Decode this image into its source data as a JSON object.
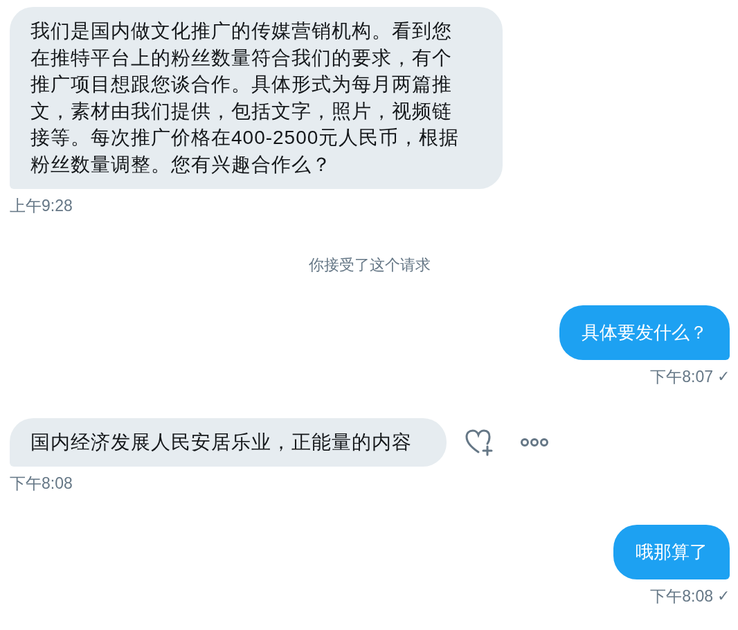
{
  "messages": [
    {
      "kind": "received",
      "text": "我们是国内做文化推广的传媒营销机构。看到您在推特平台上的粉丝数量符合我们的要求，有个推广项目想跟您谈合作。具体形式为每月两篇推文，素材由我们提供，包括文字，照片，视频链接等。每次推广价格在400-2500元人民币，根据粉丝数量调整。您有兴趣合作么？",
      "time": "上午9:28",
      "actions": false
    },
    {
      "kind": "notice",
      "text": "你接受了这个请求"
    },
    {
      "kind": "sent",
      "text": "具体要发什么？",
      "time": "下午8:07",
      "status": "✓"
    },
    {
      "kind": "received",
      "text": "国内经济发展人民安居乐业，正能量的内容",
      "time": "下午8:08",
      "actions": true
    },
    {
      "kind": "sent",
      "text": "哦那算了",
      "time": "下午8:08",
      "status": "✓"
    }
  ]
}
